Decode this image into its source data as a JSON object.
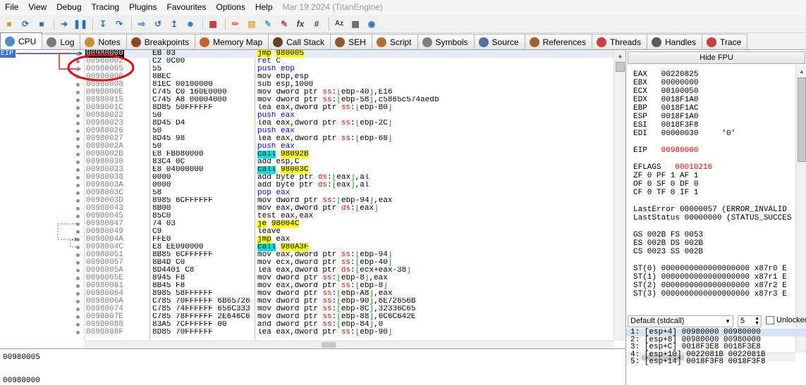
{
  "menubar": {
    "items": [
      "File",
      "View",
      "Debug",
      "Tracing",
      "Plugins",
      "Favourites",
      "Options",
      "Help"
    ],
    "date": "Mar 19 2024 (TitanEngine)"
  },
  "toolbar": {
    "buttons": [
      "open-icon",
      "restart-icon",
      "stop-icon",
      "run-icon",
      "pause-icon",
      "step-into-icon",
      "step-over-icon",
      "trace-into-icon",
      "trace-over-icon",
      "execute-till-return-icon",
      "run-to-user-code-icon",
      "animate-icon",
      "patch-icon",
      "comment-icon",
      "label-icon",
      "bookmark-icon",
      "function-icon",
      "hash-icon",
      "font-icon",
      "calculator-icon",
      "help-icon"
    ]
  },
  "tabs": [
    {
      "label": "CPU",
      "color": "#4a90c8",
      "active": true
    },
    {
      "label": "Log",
      "color": "#7a7a7a"
    },
    {
      "label": "Notes",
      "color": "#c89030"
    },
    {
      "label": "Breakpoints",
      "color": "#8a4a20"
    },
    {
      "label": "Memory Map",
      "color": "#c86030"
    },
    {
      "label": "Call Stack",
      "color": "#6a4020"
    },
    {
      "label": "SEH",
      "color": "#8a5a30"
    },
    {
      "label": "Script",
      "color": "#b07030"
    },
    {
      "label": "Symbols",
      "color": "#808080"
    },
    {
      "label": "Source",
      "color": "#5070a0"
    },
    {
      "label": "References",
      "color": "#a06030"
    },
    {
      "label": "Threads",
      "color": "#c84040"
    },
    {
      "label": "Handles",
      "color": "#5a5a5a"
    },
    {
      "label": "Trace",
      "color": "#c84040"
    }
  ],
  "eip_label": "EIP",
  "disasm": [
    {
      "addr": "00980000",
      "bytes": "EB 03",
      "instr": "<span class='kw-jmp'>jmp</span> <span class='hl'>980005</span>"
    },
    {
      "addr": "00980002",
      "bytes": "C2 0C00",
      "instr": "<span class='kw-ret'>ret C</span>"
    },
    {
      "addr": "00980005",
      "bytes": "55",
      "instr": "<span class='kw-push'>push ebp</span>"
    },
    {
      "addr": "00980006",
      "bytes": "8BEC",
      "instr": "mov ebp,esp"
    },
    {
      "addr": "00980008",
      "bytes": "81EC 00100000",
      "instr": "sub esp,1000"
    },
    {
      "addr": "0098000E",
      "bytes": "C745 C0 160E0000",
      "instr": "mov dword ptr <span class='seg'>ss</span>:<span class='bracket'>[</span>ebp-40<span class='bracket'>]</span>,E16"
    },
    {
      "addr": "00980015",
      "bytes": "C745 A8 00004000",
      "instr": "mov dword ptr <span class='seg'>ss</span>:<span class='bracket'>[</span>ebp-58<span class='bracket'>]</span>,c5865c574aedb"
    },
    {
      "addr": "0098001C",
      "bytes": "8D85 50FFFFFF",
      "instr": "lea eax,dword ptr <span class='seg'>ss</span>:<span class='bracket'>[</span>ebp-B0<span class='bracket'>]</span>"
    },
    {
      "addr": "00980022",
      "bytes": "50",
      "instr": "<span class='kw-push'>push eax</span>"
    },
    {
      "addr": "00980023",
      "bytes": "8D45 D4",
      "instr": "lea eax,dword ptr <span class='seg'>ss</span>:<span class='bracket'>[</span>ebp-2C<span class='bracket'>]</span>"
    },
    {
      "addr": "00980026",
      "bytes": "50",
      "instr": "<span class='kw-push'>push eax</span>"
    },
    {
      "addr": "00980027",
      "bytes": "8D45 98",
      "instr": "lea eax,dword ptr <span class='seg'>ss</span>:<span class='bracket'>[</span>ebp-68<span class='bracket'>]</span>"
    },
    {
      "addr": "0098002A",
      "bytes": "50",
      "instr": "<span class='kw-push'>push eax</span>"
    },
    {
      "addr": "0098002B",
      "bytes": "E8 FB080000",
      "instr": "<span class='kw-call'>call</span> <span class='hl'>98092B</span>"
    },
    {
      "addr": "00980030",
      "bytes": "83C4 0C",
      "instr": "add esp,C"
    },
    {
      "addr": "00980033",
      "bytes": "E8 04000000",
      "instr": "<span class='kw-call'>call</span> <span class='hl'>98003C</span>"
    },
    {
      "addr": "00980038",
      "bytes": "0000",
      "instr": "add byte ptr <span class='seg'>ds</span>:<span class='bracket'>[</span>eax<span class='bracket'>]</span>,al"
    },
    {
      "addr": "0098003A",
      "bytes": "0000",
      "instr": "add byte ptr <span class='seg'>ds</span>:<span class='bracket'>[</span>eax<span class='bracket'>]</span>,al"
    },
    {
      "addr": "0098003C",
      "bytes": "58",
      "instr": "<span class='kw-push'>pop eax</span>"
    },
    {
      "addr": "0098003D",
      "bytes": "8985 6CFFFFFF",
      "instr": "mov dword ptr <span class='seg'>ss</span>:<span class='bracket'>[</span>ebp-94<span class='bracket'>]</span>,eax"
    },
    {
      "addr": "00980043",
      "bytes": "8B00",
      "instr": "mov eax,dword ptr <span class='seg'>ds</span>:<span class='bracket'>[</span>eax<span class='bracket'>]</span>"
    },
    {
      "addr": "00980045",
      "bytes": "85C0",
      "instr": "test eax,eax"
    },
    {
      "addr": "00980047",
      "bytes": "74 03",
      "instr": "<span class='kw-jmp'>je</span> <span class='hl'>98004C</span>"
    },
    {
      "addr": "00980049",
      "bytes": "C9",
      "instr": "leave"
    },
    {
      "addr": "0098004A",
      "bytes": "FFE0",
      "instr": "<span class='kw-jmp'>jmp</span> eax"
    },
    {
      "addr": "0098004C",
      "bytes": "E8 EE090000",
      "instr": "<span class='kw-call'>call</span> <span class='hl'>980A3F</span>"
    },
    {
      "addr": "00980051",
      "bytes": "8B85 6CFFFFFF",
      "instr": "mov eax,dword ptr <span class='seg'>ss</span>:<span class='bracket'>[</span>ebp-94<span class='bracket'>]</span>"
    },
    {
      "addr": "00980057",
      "bytes": "8B4D C0",
      "instr": "mov ecx,dword ptr <span class='seg'>ss</span>:<span class='bracket'>[</span>ebp-40<span class='bracket'>]</span>"
    },
    {
      "addr": "0098005A",
      "bytes": "8D4401 C8",
      "instr": "lea eax,dword ptr <span class='seg'>ds</span>:<span class='bracket'>[</span>ecx+eax-38<span class='bracket'>]</span>"
    },
    {
      "addr": "0098005E",
      "bytes": "8945 F8",
      "instr": "mov dword ptr <span class='seg'>ss</span>:<span class='bracket'>[</span>ebp-8<span class='bracket'>]</span>,eax"
    },
    {
      "addr": "00980061",
      "bytes": "8B45 F8",
      "instr": "mov eax,dword ptr <span class='seg'>ss</span>:<span class='bracket'>[</span>ebp-8<span class='bracket'>]</span>"
    },
    {
      "addr": "00980064",
      "bytes": "8985 58FFFFFF",
      "instr": "mov dword ptr <span class='seg'>ss</span>:<span class='bracket'>[</span>ebp-A8<span class='bracket'>]</span>,eax"
    },
    {
      "addr": "0098006A",
      "bytes": "C785 70FFFFFF 6B65726",
      "instr": "mov dword ptr <span class='seg'>ss</span>:<span class='bracket'>[</span>ebp-90<span class='bracket'>]</span>,6E72656B"
    },
    {
      "addr": "00980074",
      "bytes": "C785 74FFFFFF 656C333",
      "instr": "mov dword ptr <span class='seg'>ss</span>:<span class='bracket'>[</span>ebp-8C<span class='bracket'>]</span>,32336C65"
    },
    {
      "addr": "0098007E",
      "bytes": "C785 78FFFFFF 2E646C6",
      "instr": "mov dword ptr <span class='seg'>ss</span>:<span class='bracket'>[</span>ebp-88<span class='bracket'>]</span>,6C6C642E"
    },
    {
      "addr": "00980088",
      "bytes": "83A5 7CFFFFFF 00",
      "instr": "and dword ptr <span class='seg'>ss</span>:<span class='bracket'>[</span>ebp-84<span class='bracket'>]</span>,0"
    },
    {
      "addr": "0098008F",
      "bytes": "8D85 70FFFFFF",
      "instr": "lea eax,dword ptr <span class='seg'>ss</span>:<span class='bracket'>[</span>ebp-90<span class='bracket'>]</span>"
    }
  ],
  "info": {
    "line1": "00980005",
    "line2": "00980000"
  },
  "right": {
    "hide_fpu": "Hide FPU",
    "registers": [
      {
        "name": "EAX",
        "value": "00220825"
      },
      {
        "name": "EBX",
        "value": "00000000"
      },
      {
        "name": "ECX",
        "value": "00100050"
      },
      {
        "name": "EDX",
        "value": "0018F1A0"
      },
      {
        "name": "EBP",
        "value": "0018F1AC"
      },
      {
        "name": "ESP",
        "value": "0018F1A0"
      },
      {
        "name": "ESI",
        "value": "0018F3F8"
      },
      {
        "name": "EDI",
        "value": "00000030",
        "extra": "'0'"
      }
    ],
    "eip": {
      "name": "EIP",
      "value": "00980000"
    },
    "eflags": {
      "name": "EFLAGS",
      "value": "00010216"
    },
    "flags": [
      "ZF 0  PF 1  AF 1",
      "OF 0  SF 0  DF 0",
      "CF 0  TF 0  IF 1"
    ],
    "lasterror": "LastError  00000057 (ERROR_INVALID",
    "laststatus": "LastStatus 00000000 (STATUS_SUCCES",
    "segs": [
      "GS 002B  FS 0053",
      "ES 002B  DS 002B",
      "CS 0023  SS 002B"
    ],
    "fpu": [
      "ST(0) 0000000000000000000 x87r0 E",
      "ST(1) 0000000000000000000 x87r1 E",
      "ST(2) 0000000000000000000 x87r2 E",
      "ST(3) 0000000000000000000 x87r3 E"
    ],
    "callconv": "Default (stdcall)",
    "stack_count": "5",
    "unlocked": "Unlocked",
    "stackargs": [
      "1: [esp+4]  00980000 00980000",
      "2: [esp+8]  00980000 00980000",
      "3: [esp+C]  0018F3E8 0018F3E8",
      "4: [esp+10] 0022081B 0022081B",
      "5: [esp+14] 0018F3F8 0018F3F8"
    ]
  }
}
